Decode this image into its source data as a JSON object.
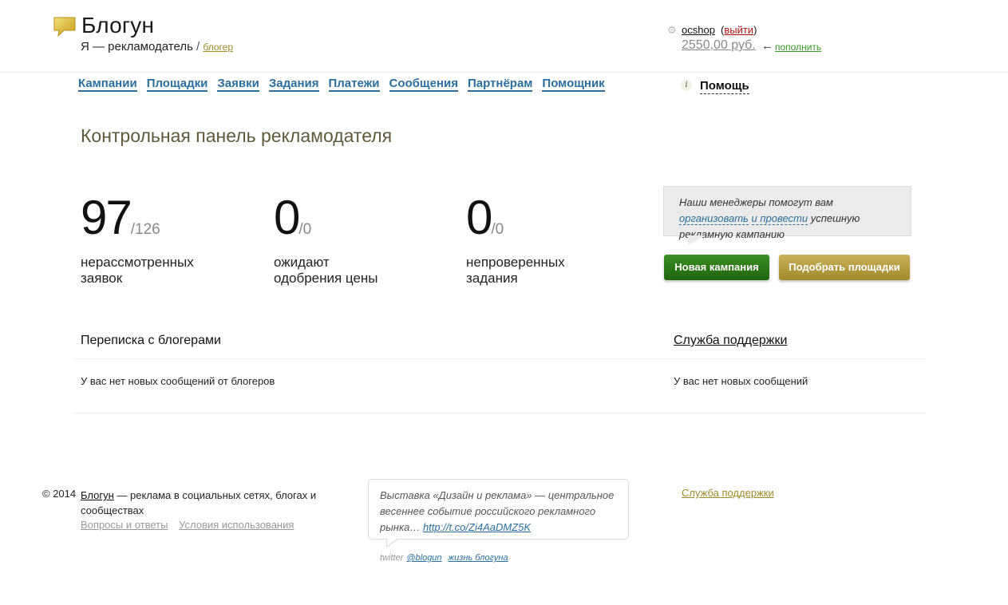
{
  "header": {
    "brand": "Блогун",
    "role_prefix": "Я — рекламодатель",
    "role_sep": " / ",
    "role_switch": "блогер",
    "logo_icon": "speech-bubble-logo-icon"
  },
  "user": {
    "username": "ocshop",
    "logout_open": "(",
    "logout_label": "выйти",
    "logout_close": ")",
    "balance": "2550,00 руб.",
    "arrow": "←",
    "topup_label": "пополнить",
    "settings_icon": "gear-icon"
  },
  "nav": {
    "items": [
      "Кампании",
      "Площадки",
      "Заявки",
      "Задания",
      "Платежи",
      "Сообщения",
      "Партнёрам",
      "Помощник"
    ],
    "help_label": "Помощь",
    "help_icon_glyph": "i"
  },
  "page_title": "Контрольная панель рекламодателя",
  "stats": [
    {
      "value": "97",
      "total": "/126",
      "label_line1": "нерассмотренных",
      "label_line2": "заявок"
    },
    {
      "value": "0",
      "total": "/0",
      "label_line1": "ожидают",
      "label_line2": "одобрения цены"
    },
    {
      "value": "0",
      "total": "/0",
      "label_line1": "непроверенных",
      "label_line2": "задания"
    }
  ],
  "hint": {
    "text_before": "Наши менеджеры помогут вам ",
    "link1": "организовать",
    "mid": " ",
    "link2": "и провести",
    "text_after": " успешную рекламную кампанию"
  },
  "buttons": {
    "new_campaign": "Новая кампания",
    "find_sites": "Подобрать площадки"
  },
  "messages": {
    "bloggers_title": "Переписка с блогерами",
    "bloggers_empty": "У вас нет новых сообщений от блогеров",
    "support_title": "Служба поддержки",
    "support_empty": "У вас нет новых сообщений"
  },
  "footer": {
    "copyright": "© 2014",
    "brand_link": "Блогун",
    "desc": " — реклама в социальных сетях, блогах и сообществах",
    "faq": "Вопросы и ответы",
    "terms": "Условия использования",
    "tweet_text": "Выставка «Дизайн и реклама» — центральное весеннее событие российского рекламного рынка… ",
    "tweet_link": "http://t.co/Zi4AaDMZ5K",
    "twitter_prefix": "twitter",
    "twitter_handle": "@blogun",
    "life_link": "жизнь блогуна",
    "support_link": "Служба поддержки"
  },
  "colors": {
    "nav_link": "#2b6f9e",
    "accent_gold": "#a08b2a",
    "green_button": "#2f7d1b",
    "logout_red": "#b01515"
  }
}
